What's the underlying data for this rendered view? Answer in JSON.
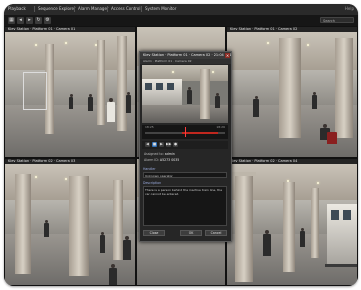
{
  "menubar": {
    "items": [
      "Playback",
      "Sequence Explorer",
      "Alarm Manager",
      "Access Control",
      "System Monitor"
    ],
    "right_label": "Help"
  },
  "toolbar": {
    "search_placeholder": "Search"
  },
  "cameras": [
    {
      "title": "Kiev Station · Platform 01 · Camera 01"
    },
    {
      "title": "Kiev Station · Platform 01 · Camera 02"
    },
    {
      "title": "Kiev Station · Platform 02 · Camera 03"
    },
    {
      "title": "Kiev Station · Platform 02 · Camera 04"
    }
  ],
  "dialog": {
    "title": "Kiev Station · Platform 01 · Camera 02 · 21:04 2012 18:25:46",
    "close_glyph": "×",
    "subtitle": "Alarm · Platform 01 · Camera 02",
    "timeline_start": "18:25",
    "timeline_end": "18:26",
    "controls": [
      "◀",
      "■",
      "▶",
      "▶▶",
      "●"
    ],
    "fields": [
      {
        "label": "Assigned to",
        "value": "admin"
      },
      {
        "label": "Alarm ID",
        "value": "A5273 0035"
      }
    ],
    "section_handler": "Handler",
    "handler_value": "Unknown operator",
    "section_description": "Description",
    "description_text": "There is a person behind the inactive train line, the car cannot be entered.",
    "buttons": [
      "Close",
      "OK",
      "Cancel"
    ]
  },
  "colors": {
    "frame": "#1c1c1c",
    "accent_red": "#c0271e",
    "accent_blue": "#2f6fb5"
  }
}
